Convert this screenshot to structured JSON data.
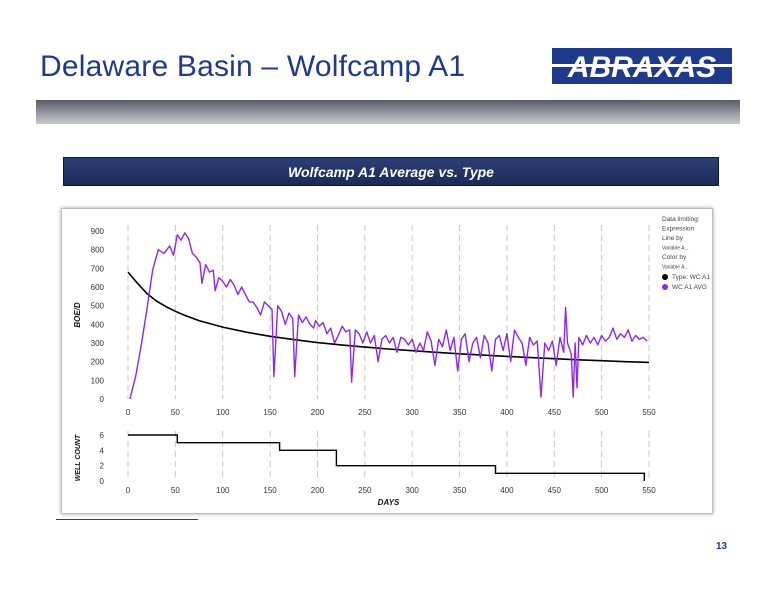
{
  "slide": {
    "title": "Delaware Basin – Wolfcamp A1",
    "logo_text": "ABRAXAS",
    "page_number": "13",
    "colors": {
      "title": "#1f3a8a",
      "header_bg": "#1b2a57",
      "type_curve": "#000000",
      "average": "#8a2be2"
    }
  },
  "chart_data": [
    {
      "type": "line",
      "title": "Wolfcamp A1 Average vs. Type",
      "ylabel": "BOE/D",
      "xlabel": "",
      "xlim": [
        0,
        550
      ],
      "ylim": [
        0,
        900
      ],
      "x_ticks": [
        0,
        50,
        100,
        150,
        200,
        250,
        300,
        350,
        400,
        450,
        500,
        550
      ],
      "y_ticks": [
        0,
        100,
        200,
        300,
        400,
        500,
        600,
        700,
        800,
        900
      ],
      "grid": "vertical dashed",
      "legend_position": "right",
      "legend_header": [
        "Data limiting:",
        "Expression",
        "Line by",
        "Variable A...",
        "Color by",
        "Variable A..."
      ],
      "series": [
        {
          "name": "Type: WC A1",
          "color": "#000000",
          "points": [
            [
              0,
              680
            ],
            [
              10,
              620
            ],
            [
              20,
              565
            ],
            [
              30,
              525
            ],
            [
              40,
              495
            ],
            [
              50,
              470
            ],
            [
              60,
              448
            ],
            [
              75,
              420
            ],
            [
              100,
              385
            ],
            [
              125,
              358
            ],
            [
              150,
              336
            ],
            [
              175,
              318
            ],
            [
              200,
              302
            ],
            [
              225,
              290
            ],
            [
              250,
              278
            ],
            [
              275,
              268
            ],
            [
              300,
              259
            ],
            [
              325,
              250
            ],
            [
              350,
              242
            ],
            [
              375,
              235
            ],
            [
              400,
              228
            ],
            [
              425,
              222
            ],
            [
              450,
              216
            ],
            [
              475,
              210
            ],
            [
              500,
              205
            ],
            [
              525,
              200
            ],
            [
              550,
              196
            ]
          ]
        },
        {
          "name": "WC A1 AVG",
          "color": "#8a2be2",
          "points": [
            [
              2,
              0
            ],
            [
              8,
              120
            ],
            [
              14,
              290
            ],
            [
              20,
              480
            ],
            [
              26,
              690
            ],
            [
              32,
              800
            ],
            [
              38,
              780
            ],
            [
              44,
              820
            ],
            [
              48,
              770
            ],
            [
              52,
              880
            ],
            [
              56,
              850
            ],
            [
              60,
              890
            ],
            [
              64,
              860
            ],
            [
              68,
              780
            ],
            [
              72,
              760
            ],
            [
              76,
              730
            ],
            [
              78,
              620
            ],
            [
              82,
              720
            ],
            [
              86,
              680
            ],
            [
              90,
              690
            ],
            [
              92,
              580
            ],
            [
              96,
              650
            ],
            [
              100,
              630
            ],
            [
              104,
              600
            ],
            [
              108,
              640
            ],
            [
              112,
              610
            ],
            [
              116,
              560
            ],
            [
              120,
              600
            ],
            [
              124,
              560
            ],
            [
              128,
              520
            ],
            [
              132,
              520
            ],
            [
              136,
              490
            ],
            [
              140,
              450
            ],
            [
              144,
              520
            ],
            [
              148,
              500
            ],
            [
              152,
              480
            ],
            [
              154,
              120
            ],
            [
              158,
              500
            ],
            [
              162,
              470
            ],
            [
              166,
              400
            ],
            [
              170,
              460
            ],
            [
              174,
              430
            ],
            [
              176,
              120
            ],
            [
              180,
              450
            ],
            [
              184,
              410
            ],
            [
              188,
              440
            ],
            [
              192,
              400
            ],
            [
              196,
              380
            ],
            [
              198,
              420
            ],
            [
              202,
              390
            ],
            [
              206,
              410
            ],
            [
              210,
              350
            ],
            [
              214,
              380
            ],
            [
              218,
              300
            ],
            [
              222,
              340
            ],
            [
              226,
              390
            ],
            [
              230,
              360
            ],
            [
              234,
              370
            ],
            [
              236,
              90
            ],
            [
              240,
              370
            ],
            [
              244,
              350
            ],
            [
              248,
              300
            ],
            [
              252,
              360
            ],
            [
              256,
              300
            ],
            [
              260,
              340
            ],
            [
              264,
              200
            ],
            [
              268,
              320
            ],
            [
              272,
              340
            ],
            [
              276,
              300
            ],
            [
              280,
              330
            ],
            [
              284,
              250
            ],
            [
              288,
              330
            ],
            [
              292,
              320
            ],
            [
              296,
              290
            ],
            [
              300,
              320
            ],
            [
              304,
              250
            ],
            [
              308,
              300
            ],
            [
              312,
              260
            ],
            [
              316,
              360
            ],
            [
              320,
              310
            ],
            [
              324,
              180
            ],
            [
              328,
              320
            ],
            [
              332,
              280
            ],
            [
              336,
              370
            ],
            [
              340,
              260
            ],
            [
              344,
              330
            ],
            [
              348,
              150
            ],
            [
              352,
              320
            ],
            [
              356,
              350
            ],
            [
              360,
              200
            ],
            [
              364,
              300
            ],
            [
              368,
              330
            ],
            [
              372,
              220
            ],
            [
              376,
              340
            ],
            [
              380,
              300
            ],
            [
              384,
              150
            ],
            [
              388,
              320
            ],
            [
              392,
              340
            ],
            [
              396,
              260
            ],
            [
              400,
              350
            ],
            [
              404,
              200
            ],
            [
              408,
              370
            ],
            [
              412,
              330
            ],
            [
              416,
              300
            ],
            [
              420,
              180
            ],
            [
              424,
              330
            ],
            [
              428,
              290
            ],
            [
              432,
              310
            ],
            [
              436,
              10
            ],
            [
              440,
              300
            ],
            [
              444,
              260
            ],
            [
              448,
              310
            ],
            [
              452,
              180
            ],
            [
              456,
              330
            ],
            [
              460,
              250
            ],
            [
              462,
              490
            ],
            [
              464,
              300
            ],
            [
              468,
              240
            ],
            [
              470,
              10
            ],
            [
              472,
              300
            ],
            [
              474,
              60
            ],
            [
              476,
              330
            ],
            [
              480,
              290
            ],
            [
              484,
              340
            ],
            [
              488,
              300
            ],
            [
              492,
              330
            ],
            [
              496,
              290
            ],
            [
              500,
              340
            ],
            [
              504,
              310
            ],
            [
              508,
              330
            ],
            [
              512,
              380
            ],
            [
              516,
              320
            ],
            [
              520,
              350
            ],
            [
              524,
              330
            ],
            [
              528,
              370
            ],
            [
              532,
              310
            ],
            [
              536,
              340
            ],
            [
              540,
              320
            ],
            [
              544,
              330
            ],
            [
              548,
              310
            ]
          ]
        }
      ]
    },
    {
      "type": "line",
      "ylabel": "WELL COUNT",
      "xlabel": "DAYS",
      "xlim": [
        0,
        550
      ],
      "ylim": [
        0,
        6
      ],
      "x_ticks": [
        0,
        50,
        100,
        150,
        200,
        250,
        300,
        350,
        400,
        450,
        500,
        550
      ],
      "y_ticks": [
        0,
        2,
        4,
        6
      ],
      "series": [
        {
          "name": "",
          "color": "#000000",
          "points": [
            [
              0,
              6
            ],
            [
              52,
              6
            ],
            [
              52,
              5
            ],
            [
              160,
              5
            ],
            [
              160,
              4
            ],
            [
              220,
              4
            ],
            [
              220,
              2
            ],
            [
              388,
              2
            ],
            [
              388,
              1
            ],
            [
              545,
              1
            ],
            [
              545,
              0
            ]
          ]
        }
      ]
    }
  ]
}
